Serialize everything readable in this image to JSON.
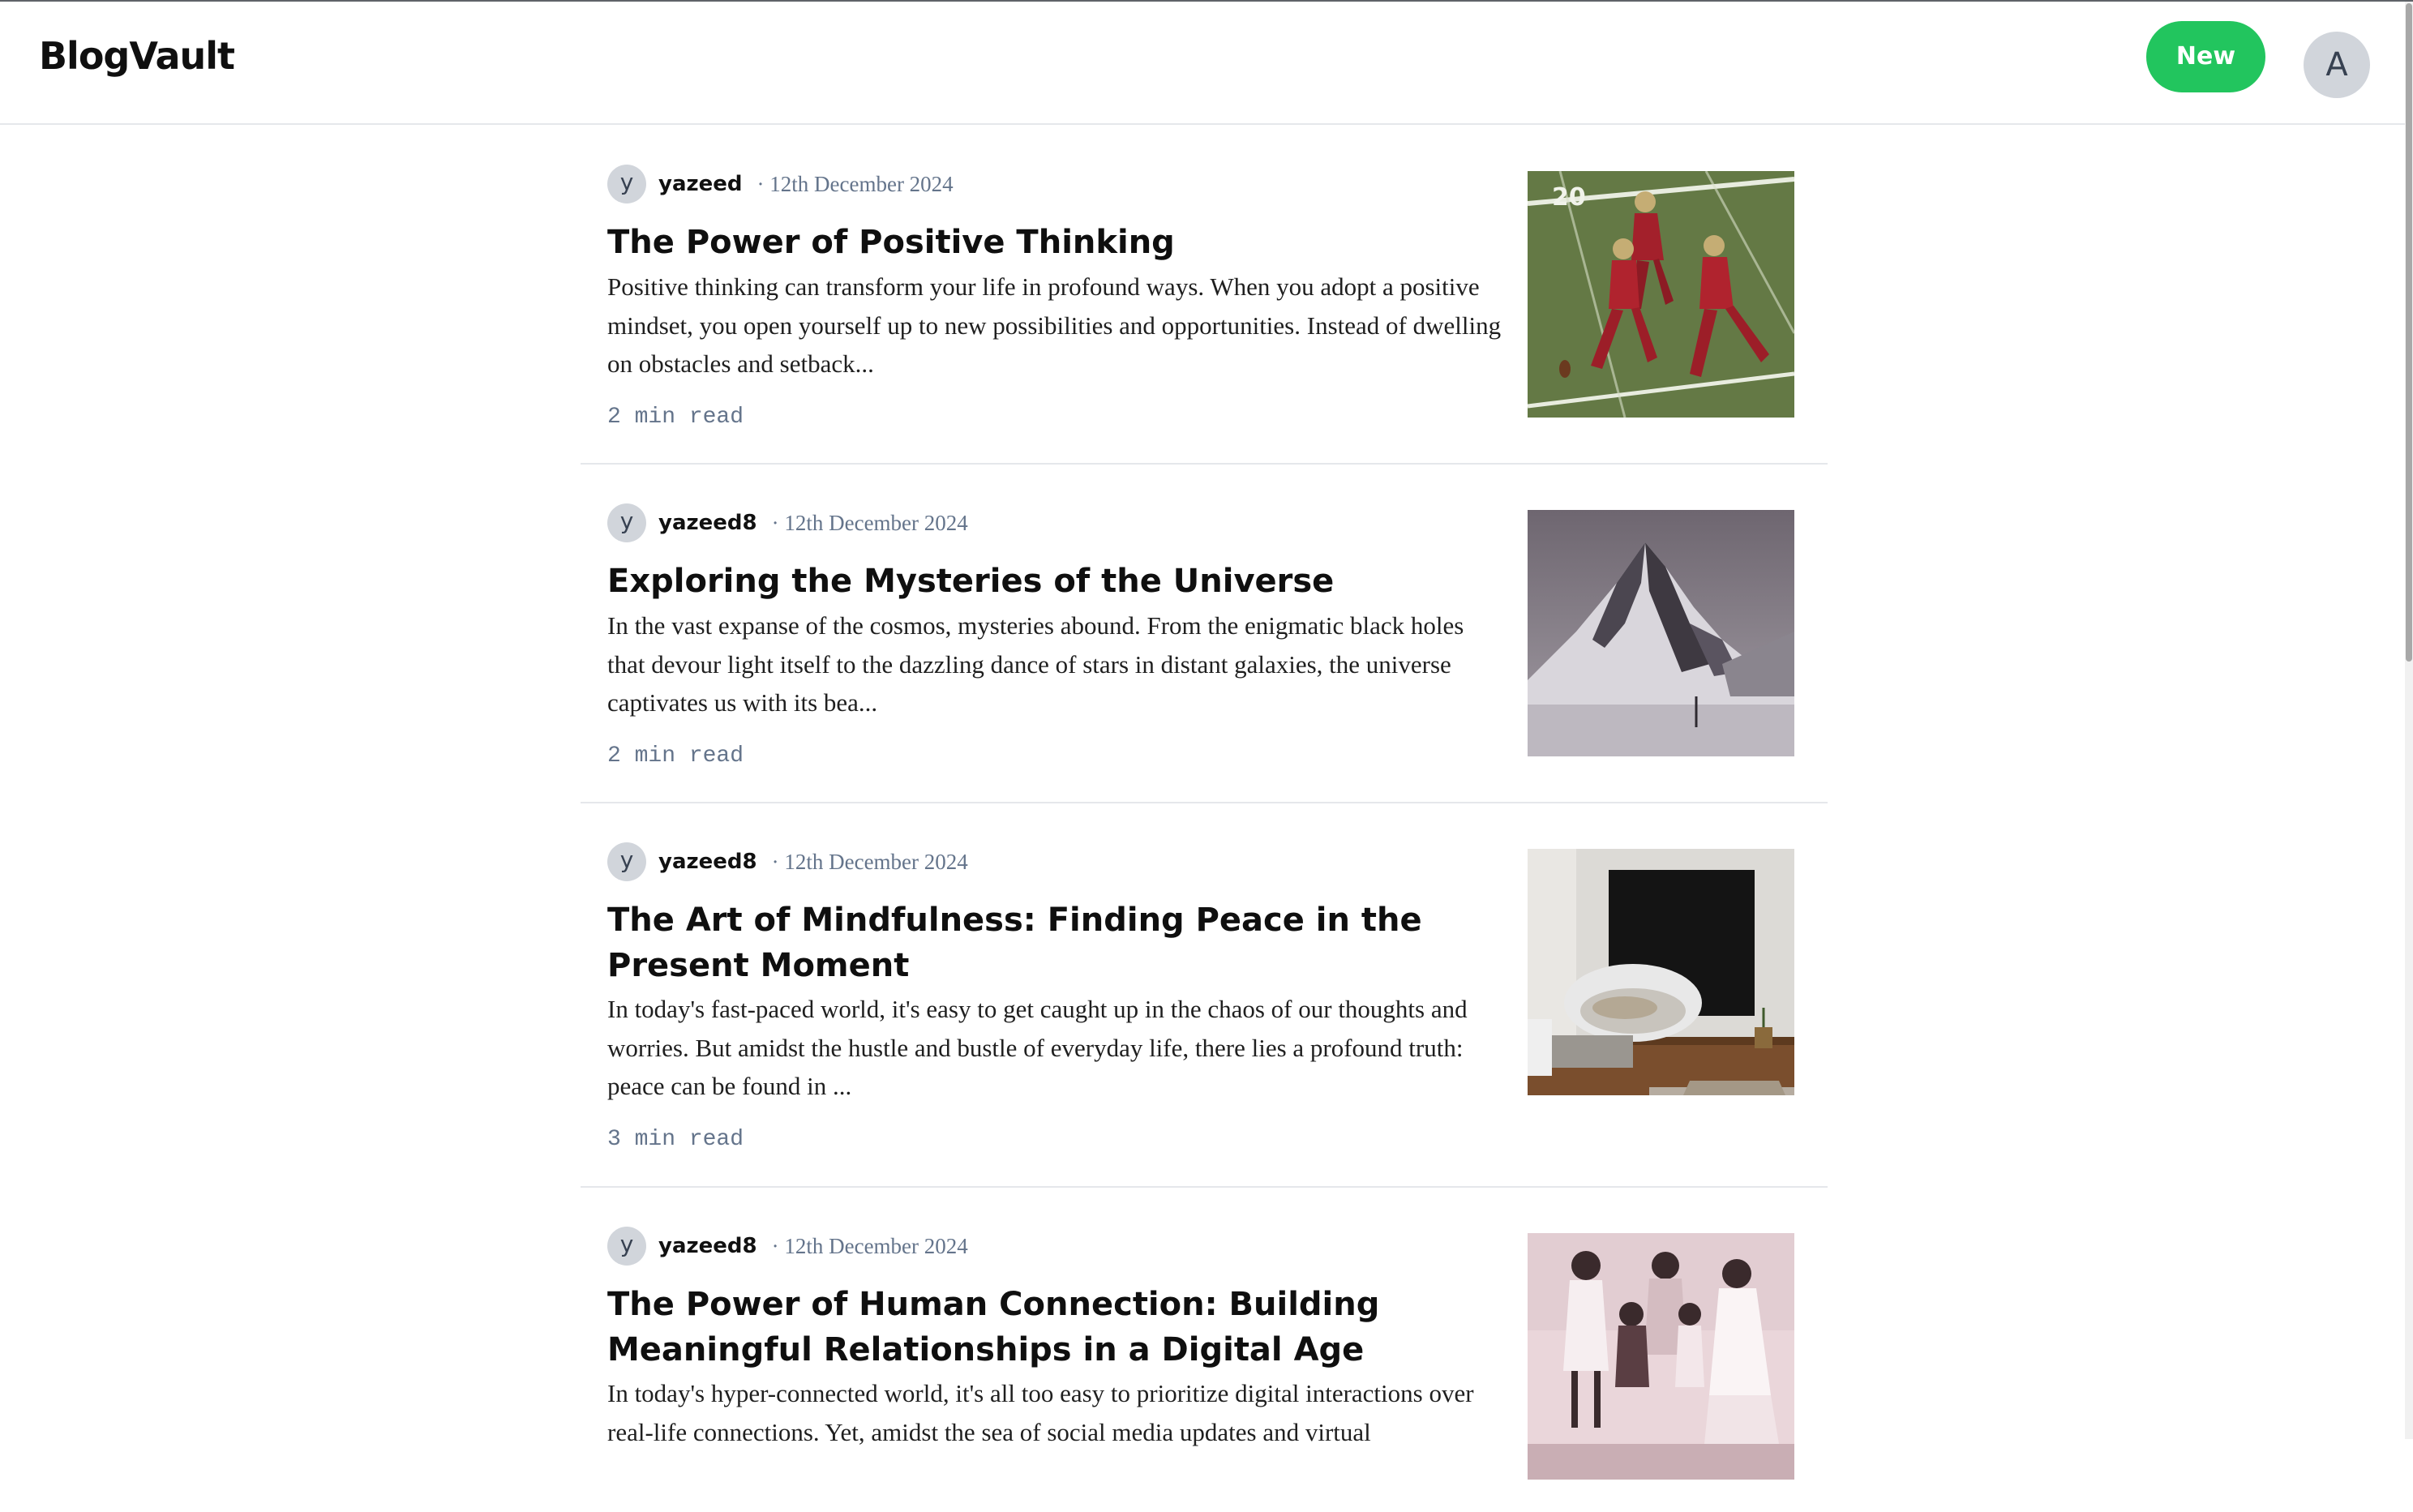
{
  "header": {
    "brand": "BlogVault",
    "new_button_label": "New",
    "avatar_initial": "A"
  },
  "posts": [
    {
      "author_initial": "y",
      "author": "yazeed",
      "date": "· 12th December 2024",
      "title": "The Power of Positive Thinking",
      "excerpt": "Positive thinking can transform your life in profound ways. When you adopt a positive mindset, you open yourself up to new possibilities and opportunities. Instead of dwelling on obstacles and setback...",
      "read_time": "2 min read",
      "image": "football-players-photo"
    },
    {
      "author_initial": "y",
      "author": "yazeed8",
      "date": "· 12th December 2024",
      "title": "Exploring the Mysteries of the Universe",
      "excerpt": "In the vast expanse of the cosmos, mysteries abound. From the enigmatic black holes that devour light itself to the dazzling dance of stars in distant galaxies, the universe captivates us with its bea...",
      "read_time": "2 min read",
      "image": "snowy-mountain-photo"
    },
    {
      "author_initial": "y",
      "author": "yazeed8",
      "date": "· 12th December 2024",
      "title": "The Art of Mindfulness: Finding Peace in the Present Moment",
      "excerpt": "In today's fast-paced world, it's easy to get caught up in the chaos of our thoughts and worries. But amidst the hustle and bustle of everyday life, there lies a profound truth: peace can be found in ...",
      "read_time": "3 min read",
      "image": "living-room-chair-photo"
    },
    {
      "author_initial": "y",
      "author": "yazeed8",
      "date": "· 12th December 2024",
      "title": "The Power of Human Connection: Building Meaningful Relationships in a Digital Age",
      "excerpt": "In today's hyper-connected world, it's all too easy to prioritize digital interactions over real-life connections. Yet, amidst the sea of social media updates and virtual",
      "read_time": "",
      "image": "vintage-group-photo"
    }
  ]
}
